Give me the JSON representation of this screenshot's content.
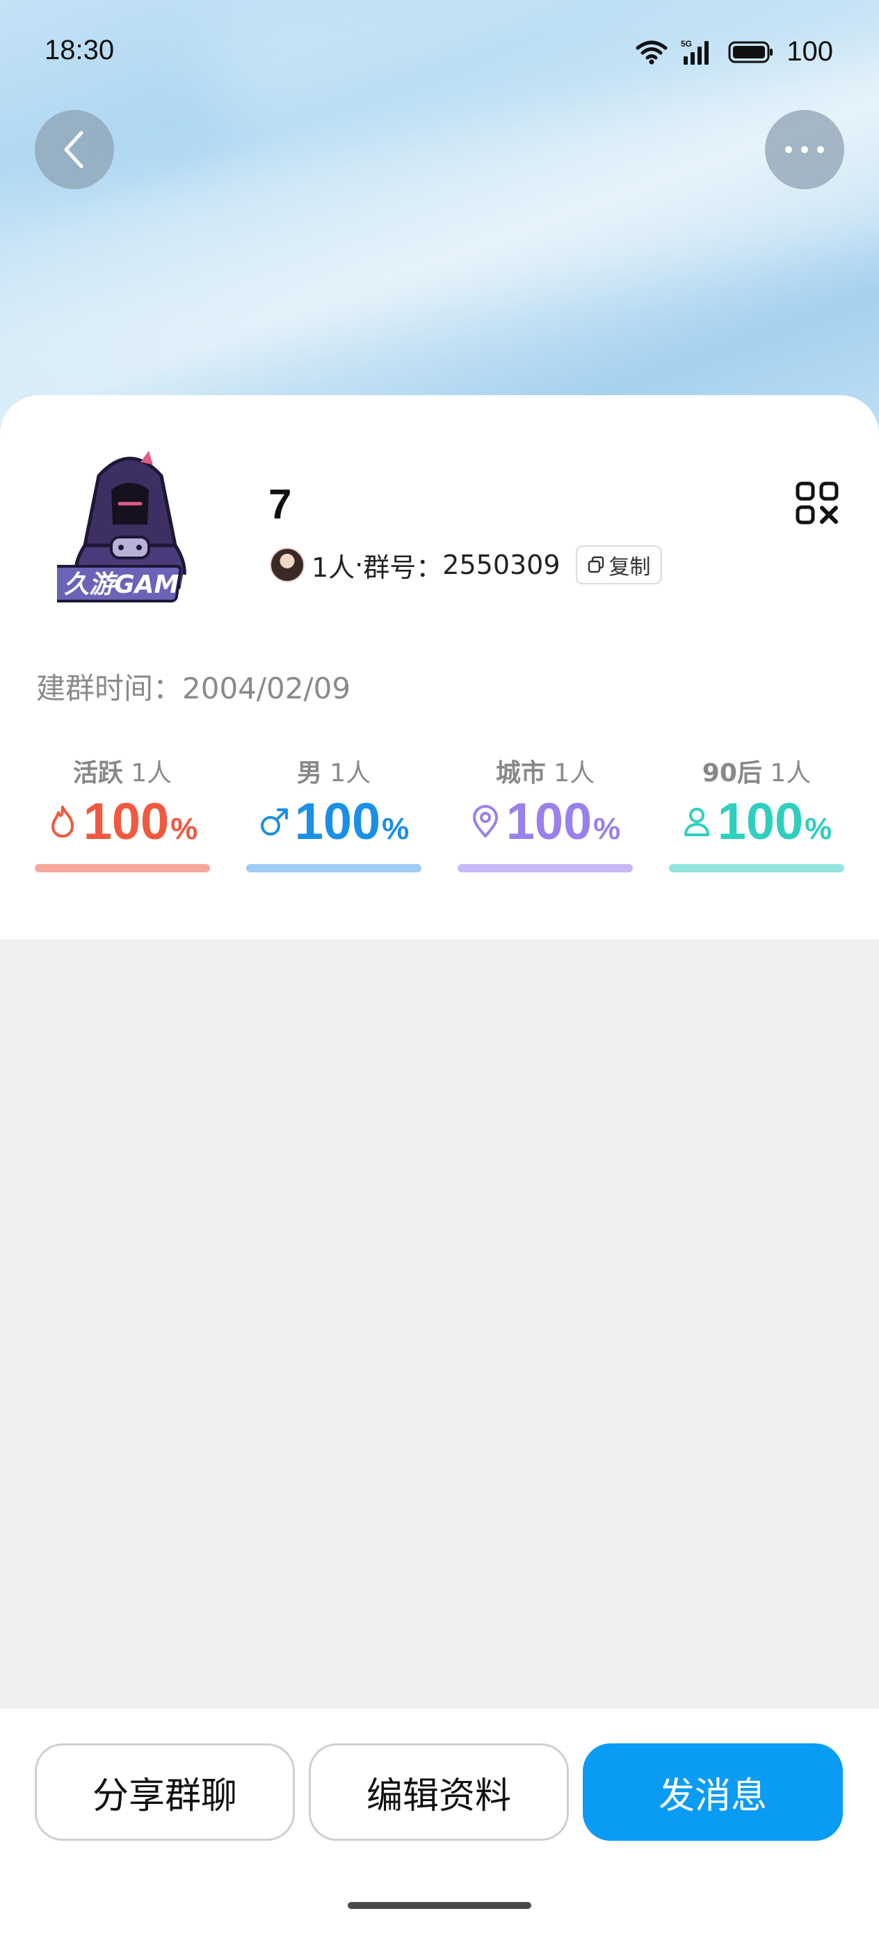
{
  "status_bar": {
    "time": "18:30",
    "battery": "100",
    "icons": [
      "wifi-icon",
      "5g-signal-icon",
      "battery-icon"
    ]
  },
  "header": {
    "back_icon": "chevron-left-icon",
    "more_icon": "more-dots-icon"
  },
  "group": {
    "name": "7",
    "avatar_logo_text": "久游GAME",
    "member_count": "1人",
    "separator": "·",
    "id_label": "群号：",
    "id_value": "2550309",
    "copy_label": "复制",
    "created_label": "建群时间：",
    "created_value": "2004/02/09"
  },
  "stats": [
    {
      "label": "活跃",
      "count": "1人",
      "value": "100",
      "unit": "%",
      "icon": "flame-icon",
      "color": "#f0583f",
      "bar_color": "#f7a89b",
      "percent": 100
    },
    {
      "label": "男",
      "count": "1人",
      "value": "100",
      "unit": "%",
      "icon": "male-icon",
      "color": "#1a8fe6",
      "bar_color": "#9fcdf5",
      "percent": 100
    },
    {
      "label": "城市",
      "count": "1人",
      "value": "100",
      "unit": "%",
      "icon": "location-pin-icon",
      "color": "#9a80ec",
      "bar_color": "#c8b9f6",
      "percent": 100
    },
    {
      "label": "90后",
      "count": "1人",
      "value": "100",
      "unit": "%",
      "icon": "person-icon",
      "color": "#2fcfbf",
      "bar_color": "#93e5de",
      "percent": 100
    }
  ],
  "actions": {
    "share": "分享群聊",
    "edit": "编辑资料",
    "message": "发消息"
  },
  "colors": {
    "primary": "#0a9bf5",
    "background": "#eff0f2"
  }
}
